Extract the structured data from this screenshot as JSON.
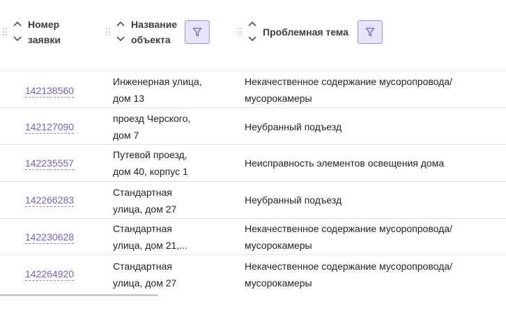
{
  "header": {
    "col1_line1": "Номер",
    "col1_line2": "заявки",
    "col2_line1": "Название",
    "col2_line2": "объекта",
    "col3": "Проблемная тема"
  },
  "icons": {
    "drag": "drag-handle-icon",
    "sort": "sort-chevrons-icon",
    "filter": "funnel-icon"
  },
  "colors": {
    "link": "#6c64c8",
    "filter_bg": "#e7e4f8",
    "filter_border": "#9b93d8"
  },
  "rows": [
    {
      "id": "142138560",
      "addr1": "Инженерная улица,",
      "addr2": "дом 13",
      "topic1": "Некачественное содержание мусоропровода/",
      "topic2": "мусорокамеры"
    },
    {
      "id": "142127090",
      "addr1": "проезд Черского,",
      "addr2": "дом 7",
      "topic1": "Неубранный подъезд",
      "topic2": ""
    },
    {
      "id": "142235557",
      "addr1": "Путевой проезд,",
      "addr2": "дом 40, корпус 1",
      "topic1": "Неисправность элементов освещения дома",
      "topic2": ""
    },
    {
      "id": "142266283",
      "addr1": "Стандартная",
      "addr2": "улица, дом 27",
      "topic1": "Неубранный подъезд",
      "topic2": ""
    },
    {
      "id": "142230628",
      "addr1": "Стандартная",
      "addr2": "улица, дом 21,...",
      "topic1": "Некачественное содержание мусоропровода/",
      "topic2": "мусорокамеры"
    },
    {
      "id": "142264920",
      "addr1": "Стандартная",
      "addr2": "улица, дом 27",
      "topic1": "Некачественное содержание мусоропровода/",
      "topic2": "мусорокамеры"
    }
  ]
}
